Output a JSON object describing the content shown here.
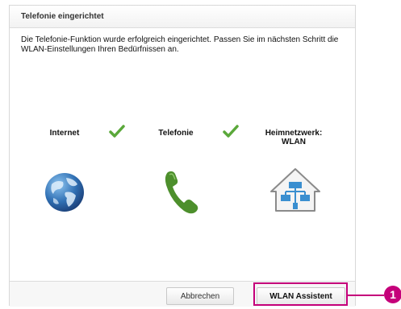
{
  "dialog": {
    "title": "Telefonie eingerichtet",
    "description": "Die Telefonie-Funktion wurde erfolgreich eingerichtet. Passen Sie im nächsten Schritt die WLAN-Einstellungen Ihren Bedürfnissen an."
  },
  "steps": [
    {
      "label": "Internet",
      "done": true,
      "icon": "globe-icon"
    },
    {
      "label": "Telefonie",
      "done": true,
      "icon": "phone-icon"
    },
    {
      "label_line1": "Heimnetzwerk:",
      "label_line2": "WLAN",
      "done": false,
      "icon": "home-network-icon"
    }
  ],
  "buttons": {
    "cancel": "Abbrechen",
    "wlan_assistant": "WLAN Assistent"
  },
  "annotation": {
    "marker": "1"
  },
  "colors": {
    "check": "#5aa83a",
    "accent": "#c5007a",
    "globe": "#2f6fb3",
    "phone": "#4d8f2c",
    "house": "#3a8fd0"
  }
}
